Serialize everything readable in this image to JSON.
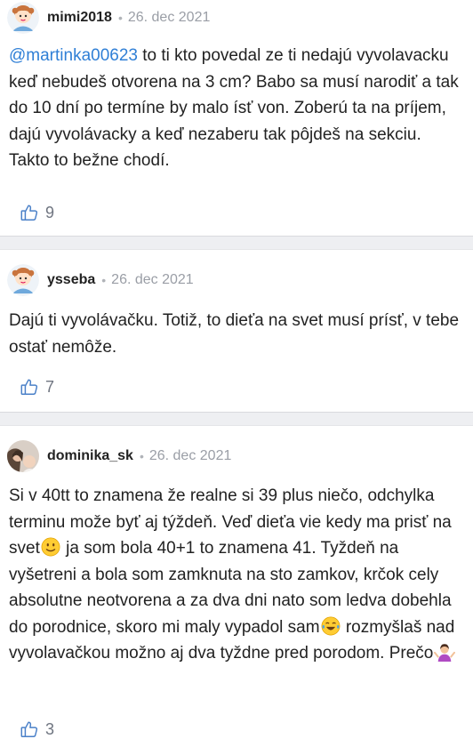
{
  "comments": [
    {
      "author": "mimi2018",
      "date": "26. dec 2021",
      "mention": "@martinka00623",
      "text": " to ti kto povedal ze ti nedajú vyvolavacku keď nebudeš otvorena na 3 cm? Babo sa musí narodiť a tak do 10 dní po termíne by malo ísť von. Zoberú ta na príjem, dajú vyvolávacky a keď nezaberu tak pôjdeš na sekciu. Takto to bežne chodí.",
      "likes": "9",
      "avatar_icon": "girl-avatar-icon"
    },
    {
      "author": "ysseba",
      "date": "26. dec 2021",
      "text": "Dajú ti vyvolávačku. Totiž, to dieťa na svet musí prísť, v tebe ostať nemôže.",
      "likes": "7",
      "avatar_icon": "girl-avatar-icon"
    },
    {
      "author": "dominika_sk",
      "date": "26. dec 2021",
      "text_1": "Si v 40tt to znamena že realne si 39 plus niečo, odchylka terminu može byť aj týždeň. Veď dieťa vie kedy ma prisť na svet",
      "text_2": " ja som bola 40+1 to znamena 41. Tyždeň na vyšetreni a bola som zamknuta na sto zamkov, krčok cely absolutne neotvorena a za dva dni nato som ledva dobehla do porodnice, skoro mi maly vypadol sam",
      "text_3": " rozmyšlaš nad vyvolavačkou možno aj dva tyždne pred porodom. Prečo",
      "likes": "3",
      "avatar_icon": "photo-avatar"
    }
  ],
  "colors": {
    "text": "#222222",
    "mention": "#2f7fd6",
    "meta": "#9a9ea6",
    "separator": "#eeeff2"
  },
  "icons": [
    "thumbs-up-icon",
    "slightly-smiling-face-emoji",
    "tears-of-joy-emoji",
    "woman-shrugging-emoji"
  ]
}
